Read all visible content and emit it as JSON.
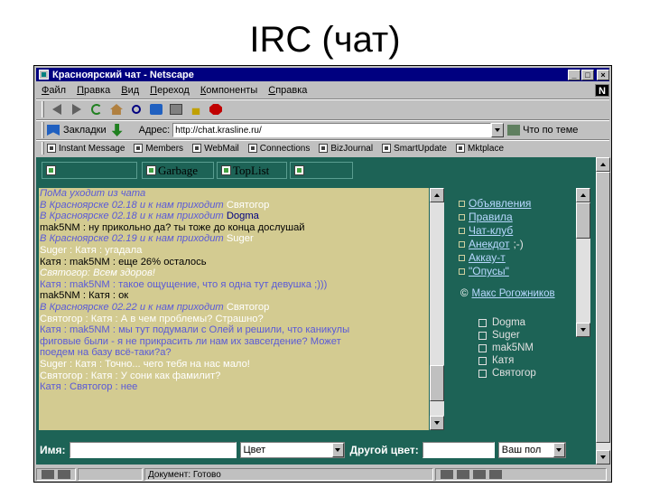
{
  "slide": {
    "title": "IRC (чат)"
  },
  "window": {
    "title": "Красноярский чат - Netscape",
    "controls": {
      "minimize": "_",
      "maximize": "□",
      "close": "×"
    }
  },
  "menu": [
    "Файл",
    "Правка",
    "Вид",
    "Переход",
    "Компоненты",
    "Справка"
  ],
  "toolbar": {
    "icons": [
      "back-icon",
      "forward-icon",
      "reload-icon",
      "home-icon",
      "search-icon",
      "guide-icon",
      "print-icon",
      "security-icon",
      "stop-icon"
    ]
  },
  "location": {
    "bookmarks_label": "Закладки",
    "address_label": "Адрес:",
    "address_value": "http://chat.krasline.ru/",
    "whats_related": "Что по теме"
  },
  "personal_toolbar": [
    "Instant Message",
    "Members",
    "WebMail",
    "Connections",
    "BizJournal",
    "SmartUpdate",
    "Mktplace"
  ],
  "frame_tabs": [
    "",
    "Garbage",
    "TopList",
    ""
  ],
  "chat": {
    "lines": [
      {
        "nick": "",
        "text": "ПоМа уходит из чата",
        "color": "#5a5ad8",
        "italic": true
      },
      {
        "nick": "",
        "text": "В Красноярске 02.18 и к нам приходит ",
        "extra": "Святогор",
        "color": "#5a5ad8",
        "extra_color": "#ffffff",
        "italic": true
      },
      {
        "nick": "",
        "text": "В Красноярске 02.18 и к нам приходит ",
        "extra": "Dogma",
        "color": "#5a5ad8",
        "extra_color": "#000080",
        "italic": true
      },
      {
        "nick": "",
        "text": "mak5NM : ну прикольно да? ты тоже до конца дослушай",
        "color": "#000000",
        "italic": false
      },
      {
        "nick": "",
        "text": "В Красноярске 02.19 и к нам приходит ",
        "extra": "Suger",
        "color": "#5a5ad8",
        "extra_color": "#ffffff",
        "italic": true
      },
      {
        "nick": "",
        "text": "Suger : Катя : угадала",
        "color": "#ffffff",
        "italic": false
      },
      {
        "nick": "",
        "text": "Катя : mak5NM : еще 26% осталось",
        "color": "#000000",
        "italic": false
      },
      {
        "nick": "",
        "text": "Святогор: Всем здоров!",
        "color": "#ffffff",
        "italic": true
      },
      {
        "nick": "",
        "text": "Катя : mak5NM : такое ощущение, что я одна тут девушка ;)))",
        "color": "#5a5ad8",
        "italic": false
      },
      {
        "nick": "",
        "text": "mak5NM : Катя : ок",
        "color": "#000000",
        "italic": false
      },
      {
        "nick": "",
        "text": "В Красноярске 02.22 и к нам приходит ",
        "extra": "Святогор",
        "color": "#5a5ad8",
        "extra_color": "#ffffff",
        "italic": true
      },
      {
        "nick": "",
        "text": "Святогор : Катя : А в чем проблемы? Страшно?",
        "color": "#ffffff",
        "italic": false
      },
      {
        "nick": "",
        "text": "Катя : mak5NM : мы тут подумали с Олей и решили, что каникулы",
        "color": "#5a5ad8",
        "italic": false
      },
      {
        "nick": "",
        "text": "фиговые были - я не прикрасить ли нам их завсегдение? Может",
        "color": "#5a5ad8",
        "italic": false
      },
      {
        "nick": "",
        "text": "поедем на базу всё-таки?а?",
        "color": "#5a5ad8",
        "italic": false
      },
      {
        "nick": "",
        "text": "Suger : Катя : Точно... чего тебя на нас мало!",
        "color": "#ffffff",
        "italic": false
      },
      {
        "nick": "",
        "text": "Святогор : Катя : У сони как фамилит?",
        "color": "#ffffff",
        "italic": false
      },
      {
        "nick": "",
        "text": "Катя : Святогор : нее",
        "color": "#5a5ad8",
        "italic": false
      }
    ]
  },
  "side_menu": [
    {
      "label": "Объявления",
      "extra": ""
    },
    {
      "label": "Правила",
      "extra": ""
    },
    {
      "label": "Чат-клуб",
      "extra": ""
    },
    {
      "label": "Анекдот",
      "extra": ";-)"
    },
    {
      "label": "Аккау-т",
      "extra": ""
    },
    {
      "label": "\"Опусы\"",
      "extra": ""
    }
  ],
  "copyright": {
    "symbol": "©",
    "name": "Макс Рогожников"
  },
  "users": [
    "Dogma",
    "Suger",
    "mak5NM",
    "Катя",
    "Святогор"
  ],
  "input_row": {
    "name_label": "Имя:",
    "color_select": "Цвет",
    "other_color_label": "Другой цвет:",
    "gender_select": "Ваш пол"
  },
  "status": {
    "text": "Документ: Готово"
  }
}
